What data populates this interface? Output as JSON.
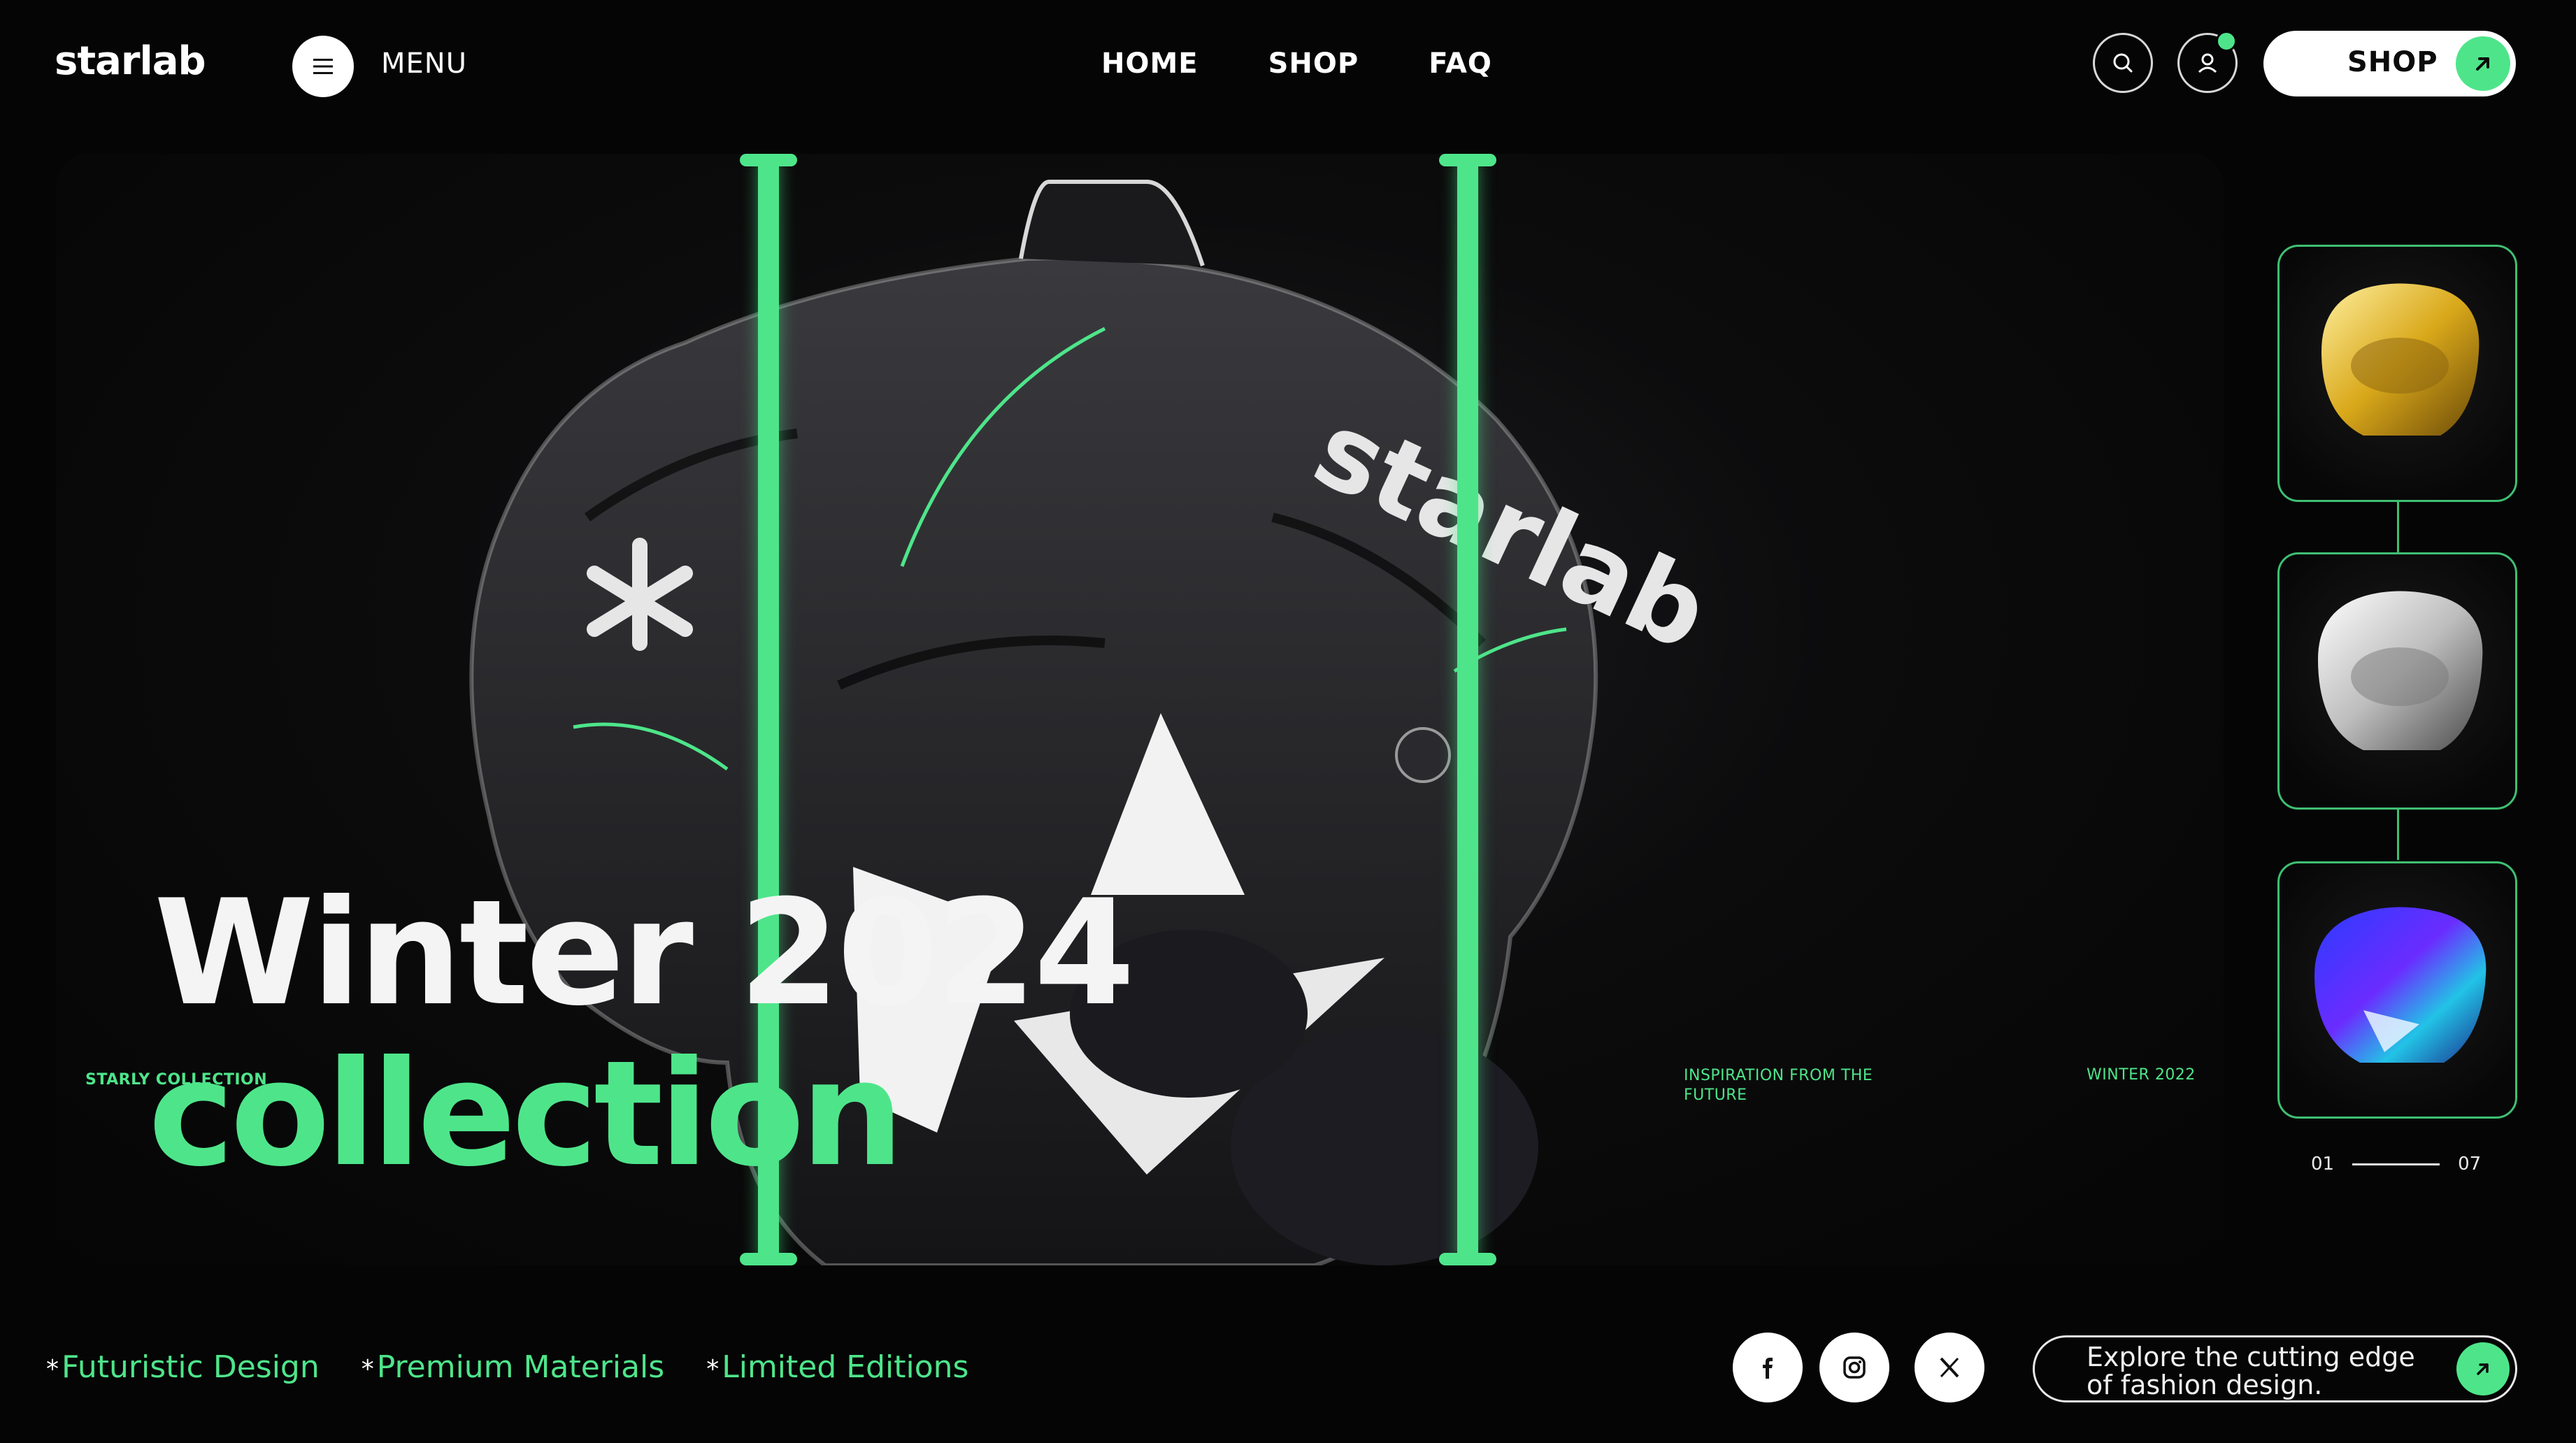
{
  "brand": {
    "logo": "starlab"
  },
  "header": {
    "menu_label": "MENU",
    "nav": [
      "HOME",
      "SHOP",
      "FAQ"
    ],
    "shop_button": "SHOP",
    "icons": [
      "search-icon",
      "user-icon",
      "menu-icon",
      "arrow-up-right-icon"
    ]
  },
  "hero": {
    "title": "Winter 2024",
    "subtitle": "collection",
    "collection_tag": "STARLY COLLECTION",
    "inspiration": "INSPIRATION FROM THE FUTURE",
    "season_tag": "WINTER 2022",
    "jacket_print": "starlab"
  },
  "carousel": {
    "current": "01",
    "total": "07",
    "items": [
      "gold-jacket",
      "silver-jacket",
      "holographic-jacket"
    ]
  },
  "footer": {
    "features": [
      "Futuristic Design",
      "Premium Materials",
      "Limited Editions"
    ],
    "social": [
      "facebook-icon",
      "instagram-icon",
      "x-icon"
    ],
    "cta_text": "Explore the cutting edge of fashion design."
  },
  "colors": {
    "accent": "#4ee58a",
    "background": "#050505",
    "text": "#ffffff"
  }
}
